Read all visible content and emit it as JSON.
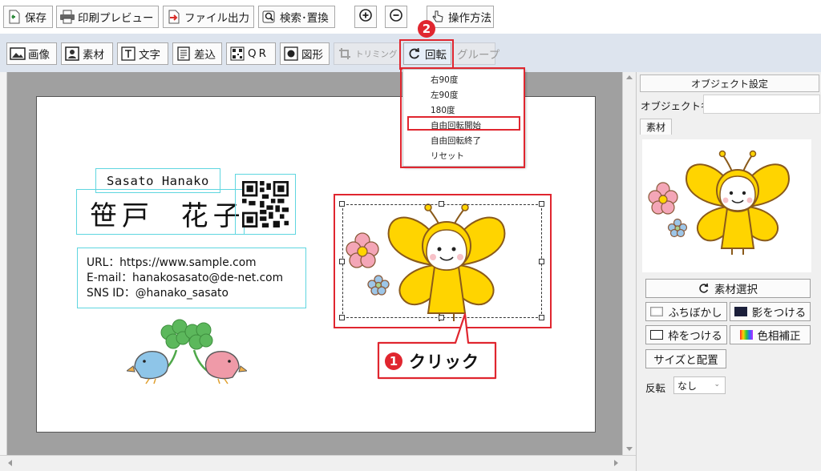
{
  "toolbar_top": {
    "save": "保存",
    "print_preview": "印刷プレビュー",
    "file_output": "ファイル出力",
    "search_replace": "検索･置換",
    "operation_help": "操作方法"
  },
  "toolbar_objects": {
    "image": "画像",
    "material": "素材",
    "text": "文字",
    "insert": "差込",
    "qr": "QR",
    "shape": "図形",
    "trimming": "トリミング",
    "rotate": "回転",
    "group": "グループ"
  },
  "rotate_menu": {
    "items": [
      "右90度",
      "左90度",
      "180度",
      "自由回転開始",
      "自由回転終了",
      "リセット"
    ],
    "highlighted": "自由回転開始"
  },
  "card": {
    "name_romaji": "Sasato Hanako",
    "name_kanji": "笹戸  花子",
    "url": "URL：https://www.sample.com",
    "email": "E-mail：hanakosasato@de-net.com",
    "sns": "SNS ID：@hanako_sasato"
  },
  "annotations": {
    "step1_number": "1",
    "step1_label": "クリック",
    "step2_number": "2"
  },
  "panel": {
    "header": "オブジェクト設定",
    "object_name_label": "オブジェクト名",
    "object_name_value": "",
    "material_tab": "素材",
    "select_material": "素材選択",
    "blur": "ふちぼかし",
    "shadow": "影をつける",
    "frame": "枠をつける",
    "hue": "色相補正",
    "size_position": "サイズと配置",
    "flip_label": "反転",
    "flip_value": "なし"
  },
  "colors": {
    "accent_red": "#e0262f",
    "toolbar_blue": "#dde4ee",
    "selection_cyan": "#5fd6e0",
    "butterfly_yellow": "#ffd400"
  }
}
